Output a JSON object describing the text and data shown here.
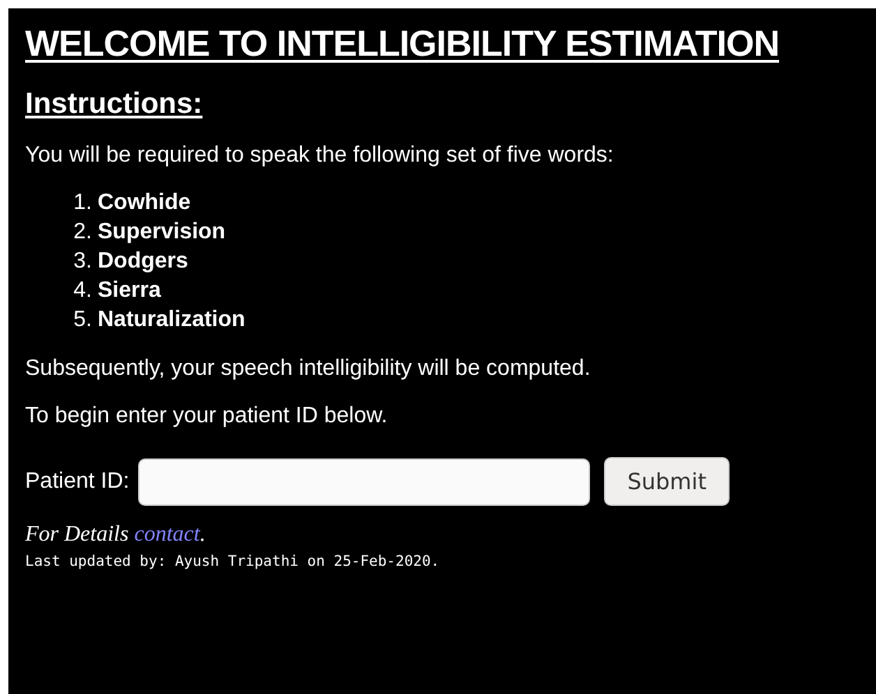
{
  "title": "WELCOME TO INTELLIGIBILITY ESTIMATION",
  "instructions_heading": "Instructions:",
  "intro": "You will be required to speak the following set of five words:",
  "words": [
    {
      "number": "1.",
      "word": "Cowhide"
    },
    {
      "number": "2.",
      "word": "Supervision"
    },
    {
      "number": "3.",
      "word": "Dodgers"
    },
    {
      "number": "4.",
      "word": "Sierra"
    },
    {
      "number": "5.",
      "word": "Naturalization"
    }
  ],
  "subsequent": "Subsequently, your speech intelligibility will be computed.",
  "begin": "To begin enter your patient ID below.",
  "form": {
    "label": "Patient ID:",
    "button": "Submit"
  },
  "details": {
    "text": "For Details",
    "link": "contact",
    "end": "."
  },
  "updated": "Last updated by: Ayush Tripathi on 25-Feb-2020."
}
